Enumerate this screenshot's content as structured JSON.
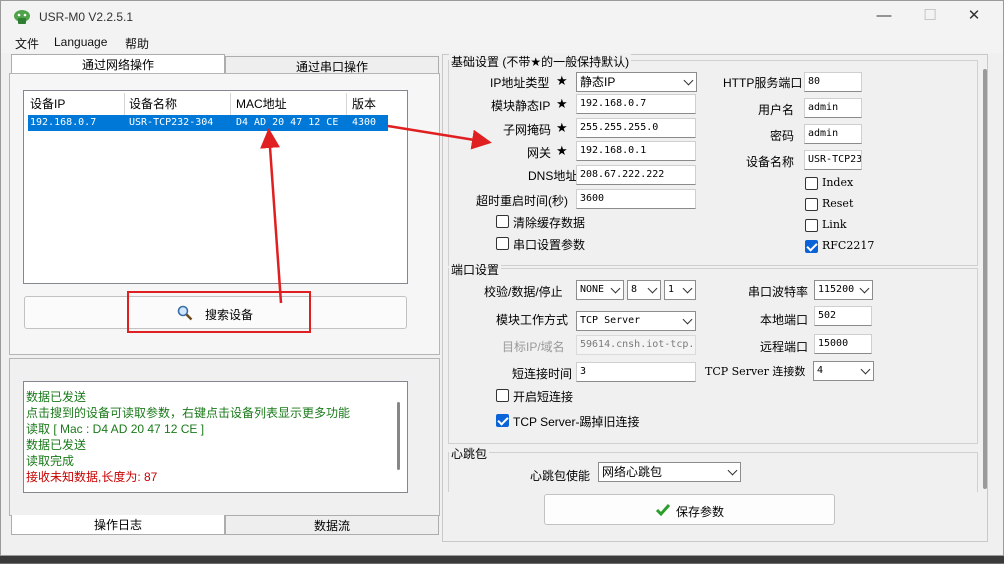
{
  "window": {
    "title": "USR-M0 V2.2.5.1",
    "minimize": "—",
    "maximize": "☐",
    "close": "✕"
  },
  "menu": [
    "文件",
    "Language",
    "帮助"
  ],
  "left_tabs": {
    "network": "通过网络操作",
    "serial": "通过串口操作"
  },
  "device_list": {
    "headers": [
      "设备IP",
      "设备名称",
      "MAC地址",
      "版本"
    ],
    "rows": [
      {
        "ip": "192.168.0.7",
        "name": "USR-TCP232-304",
        "mac": "D4 AD 20 47 12 CE",
        "version": "4300"
      }
    ]
  },
  "search_button": "搜索设备",
  "log": {
    "lines": [
      {
        "text": "数据已发送",
        "color": "green"
      },
      {
        "text": "点击搜到的设备可读取参数，右键点击设备列表显示更多功能",
        "color": "green"
      },
      {
        "text": "读取 [ Mac : D4 AD 20 47 12 CE ]",
        "color": "green"
      },
      {
        "text": "数据已发送",
        "color": "green"
      },
      {
        "text": "读取完成",
        "color": "green"
      },
      {
        "text": " 接收未知数据,长度为: 87",
        "color": "red"
      }
    ]
  },
  "bottom_tabs": {
    "log": "操作日志",
    "stream": "数据流"
  },
  "basic": {
    "title": "基础设置 (不带★的一般保持默认)",
    "star": "★",
    "ip_type_label": "IP地址类型",
    "ip_type_value": "静态IP",
    "static_ip_label": "模块静态IP",
    "static_ip_value": "192.168.0.7",
    "mask_label": "子网掩码",
    "mask_value": "255.255.255.0",
    "gateway_label": "网关",
    "gateway_value": "192.168.0.1",
    "dns_label": "DNS地址",
    "dns_value": "208.67.222.222",
    "timeout_label": "超时重启时间(秒)",
    "timeout_value": "3600",
    "clear_cache_label": "清除缓存数据",
    "serial_param_label": "串口设置参数",
    "http_port_label": "HTTP服务端口",
    "http_port_value": "80",
    "username_label": "用户名",
    "username_value": "admin",
    "password_label": "密码",
    "password_value": "admin",
    "devname_label": "设备名称",
    "devname_value": "USR-TCP23",
    "index_label": "Index",
    "reset_label": "Reset",
    "link_label": "Link",
    "rfc_label": "RFC2217"
  },
  "port": {
    "title": "端口设置",
    "parity_label": "校验/数据/停止",
    "parity_value": "NONE",
    "databits_value": "8",
    "stopbits_value": "1",
    "baud_label": "串口波特率",
    "baud_value": "115200",
    "mode_label": "模块工作方式",
    "mode_value": "TCP Server",
    "local_port_label": "本地端口",
    "local_port_value": "502",
    "target_label": "目标IP/域名",
    "target_value": "59614.cnsh.iot-tcp.",
    "remote_port_label": "远程端口",
    "remote_port_value": "15000",
    "short_time_label": "短连接时间",
    "short_time_value": "3",
    "max_conn_label": "TCP Server 连接数",
    "max_conn_value": "4",
    "short_conn_label": "开启短连接",
    "kick_label": "TCP Server-踢掉旧连接"
  },
  "heartbeat": {
    "title": "心跳包",
    "enable_label": "心跳包使能",
    "enable_value": "网络心跳包"
  },
  "save_button": "保存参数",
  "colors": {
    "selection": "#0078d7",
    "annotation": "#e02020",
    "log_green": "#1a7a1a",
    "log_red": "#c80000"
  },
  "icons": {
    "search": "magnifier-icon",
    "save": "checkmark-icon"
  }
}
